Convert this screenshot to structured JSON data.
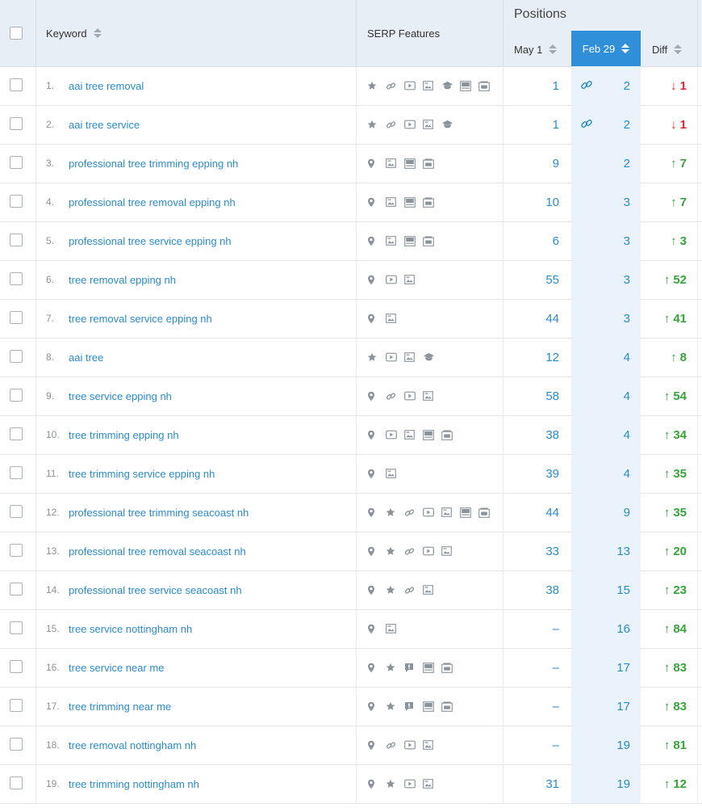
{
  "header": {
    "keyword": "Keyword",
    "serp": "SERP Features",
    "positions": "Positions",
    "may": "May 1",
    "feb": "Feb 29",
    "diff": "Diff"
  },
  "colors": {
    "link": "#2b8ccc",
    "up": "#37a33b",
    "down": "#d8282d",
    "accent": "#2f8fd8",
    "header_bg": "#e8eef5"
  },
  "rows": [
    {
      "n": "1.",
      "kw": "aai tree removal",
      "f": [
        "star",
        "link",
        "video",
        "image",
        "edu",
        "ad",
        "ad2"
      ],
      "may": "1",
      "feb": "2",
      "link": true,
      "dir": "down",
      "arrow": "↓",
      "diff": "1"
    },
    {
      "n": "2.",
      "kw": "aai tree service",
      "f": [
        "star",
        "link",
        "video",
        "image",
        "edu"
      ],
      "may": "1",
      "feb": "2",
      "link": true,
      "dir": "down",
      "arrow": "↓",
      "diff": "1"
    },
    {
      "n": "3.",
      "kw": "professional tree trimming epping nh",
      "f": [
        "pin",
        "image",
        "ad",
        "ad2"
      ],
      "may": "9",
      "feb": "2",
      "link": false,
      "dir": "up",
      "arrow": "↑",
      "diff": "7"
    },
    {
      "n": "4.",
      "kw": "professional tree removal epping nh",
      "f": [
        "pin",
        "image",
        "ad",
        "ad2"
      ],
      "may": "10",
      "feb": "3",
      "link": false,
      "dir": "up",
      "arrow": "↑",
      "diff": "7"
    },
    {
      "n": "5.",
      "kw": "professional tree service epping nh",
      "f": [
        "pin",
        "image",
        "ad",
        "ad2"
      ],
      "may": "6",
      "feb": "3",
      "link": false,
      "dir": "up",
      "arrow": "↑",
      "diff": "3"
    },
    {
      "n": "6.",
      "kw": "tree removal epping nh",
      "f": [
        "pin",
        "video",
        "image"
      ],
      "may": "55",
      "feb": "3",
      "link": false,
      "dir": "up",
      "arrow": "↑",
      "diff": "52"
    },
    {
      "n": "7.",
      "kw": "tree removal service epping nh",
      "f": [
        "pin",
        "image"
      ],
      "may": "44",
      "feb": "3",
      "link": false,
      "dir": "up",
      "arrow": "↑",
      "diff": "41"
    },
    {
      "n": "8.",
      "kw": "aai tree",
      "f": [
        "star",
        "video",
        "image",
        "edu"
      ],
      "may": "12",
      "feb": "4",
      "link": false,
      "dir": "up",
      "arrow": "↑",
      "diff": "8"
    },
    {
      "n": "9.",
      "kw": "tree service epping nh",
      "f": [
        "pin",
        "link",
        "video",
        "image"
      ],
      "may": "58",
      "feb": "4",
      "link": false,
      "dir": "up",
      "arrow": "↑",
      "diff": "54"
    },
    {
      "n": "10.",
      "kw": "tree trimming epping nh",
      "f": [
        "pin",
        "video",
        "image",
        "ad",
        "ad2"
      ],
      "may": "38",
      "feb": "4",
      "link": false,
      "dir": "up",
      "arrow": "↑",
      "diff": "34"
    },
    {
      "n": "11.",
      "kw": "tree trimming service epping nh",
      "f": [
        "pin",
        "image"
      ],
      "may": "39",
      "feb": "4",
      "link": false,
      "dir": "up",
      "arrow": "↑",
      "diff": "35"
    },
    {
      "n": "12.",
      "kw": "professional tree trimming seacoast nh",
      "f": [
        "pin",
        "star",
        "link",
        "video",
        "image",
        "ad",
        "ad2"
      ],
      "may": "44",
      "feb": "9",
      "link": false,
      "dir": "up",
      "arrow": "↑",
      "diff": "35"
    },
    {
      "n": "13.",
      "kw": "professional tree removal seacoast nh",
      "f": [
        "pin",
        "star",
        "link",
        "video",
        "image"
      ],
      "may": "33",
      "feb": "13",
      "link": false,
      "dir": "up",
      "arrow": "↑",
      "diff": "20"
    },
    {
      "n": "14.",
      "kw": "professional tree service seacoast nh",
      "f": [
        "pin",
        "star",
        "link",
        "image"
      ],
      "may": "38",
      "feb": "15",
      "link": false,
      "dir": "up",
      "arrow": "↑",
      "diff": "23"
    },
    {
      "n": "15.",
      "kw": "tree service nottingham nh",
      "f": [
        "pin",
        "image"
      ],
      "may": "–",
      "feb": "16",
      "link": false,
      "dir": "up",
      "arrow": "↑",
      "diff": "84"
    },
    {
      "n": "16.",
      "kw": "tree service near me",
      "f": [
        "pin",
        "star",
        "faq",
        "ad",
        "ad2"
      ],
      "may": "–",
      "feb": "17",
      "link": false,
      "dir": "up",
      "arrow": "↑",
      "diff": "83"
    },
    {
      "n": "17.",
      "kw": "tree trimming near me",
      "f": [
        "pin",
        "star",
        "faq",
        "ad",
        "ad2"
      ],
      "may": "–",
      "feb": "17",
      "link": false,
      "dir": "up",
      "arrow": "↑",
      "diff": "83"
    },
    {
      "n": "18.",
      "kw": "tree removal nottingham nh",
      "f": [
        "pin",
        "link",
        "video",
        "image"
      ],
      "may": "–",
      "feb": "19",
      "link": false,
      "dir": "up",
      "arrow": "↑",
      "diff": "81"
    },
    {
      "n": "19.",
      "kw": "tree trimming nottingham nh",
      "f": [
        "pin",
        "star",
        "video",
        "image"
      ],
      "may": "31",
      "feb": "19",
      "link": false,
      "dir": "up",
      "arrow": "↑",
      "diff": "12"
    }
  ]
}
